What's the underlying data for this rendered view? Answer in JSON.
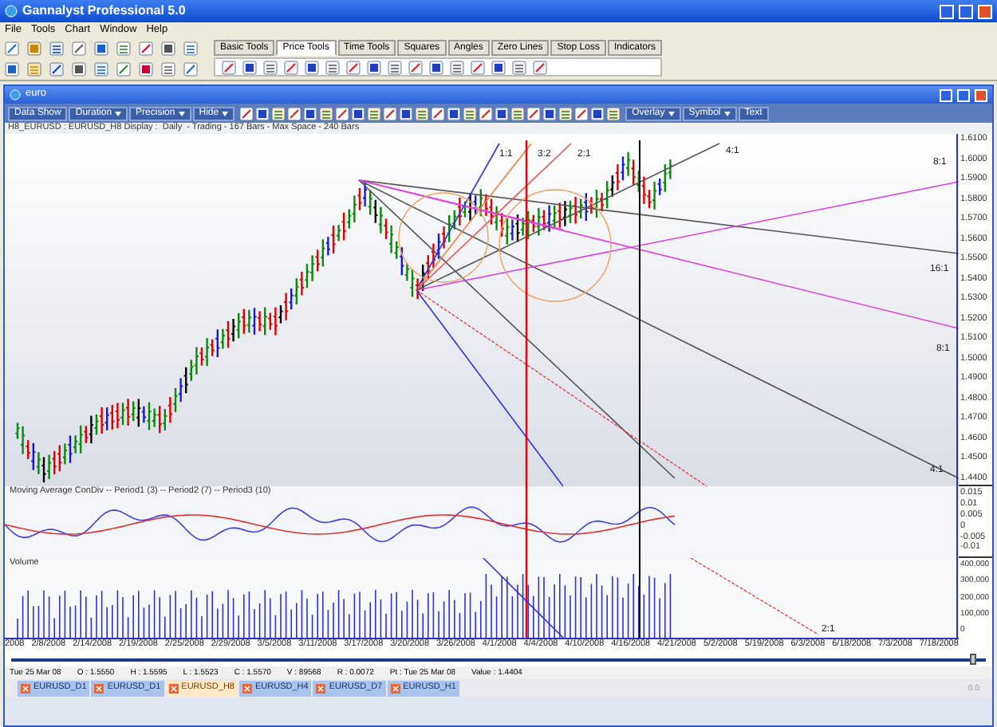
{
  "window": {
    "title": "Gannalyst Professional 5.0"
  },
  "menu": [
    "File",
    "Tools",
    "Chart",
    "Window",
    "Help"
  ],
  "tool_tabs": [
    {
      "label": "Basic Tools",
      "selected": false
    },
    {
      "label": "Price Tools",
      "selected": true
    },
    {
      "label": "Time Tools",
      "selected": false
    },
    {
      "label": "Squares",
      "selected": false
    },
    {
      "label": "Angles",
      "selected": false
    },
    {
      "label": "Zero Lines",
      "selected": false
    },
    {
      "label": "Stop Loss",
      "selected": false
    },
    {
      "label": "Indicators",
      "selected": false
    }
  ],
  "chart_window": {
    "title": "euro",
    "toolbar_left": [
      {
        "kind": "button",
        "label": "Data Show"
      },
      {
        "kind": "dropdown",
        "label": "Duration"
      },
      {
        "kind": "dropdown",
        "label": "Precision"
      },
      {
        "kind": "dropdown",
        "label": "Hide"
      }
    ],
    "toolbar_right": [
      {
        "kind": "dropdown",
        "label": "Overlay"
      },
      {
        "kind": "dropdown",
        "label": "Symbol"
      },
      {
        "kind": "button",
        "label": "Text"
      }
    ],
    "info": "H8_EURUSD : EURUSD_H8 Display :  Daily  - Trading - 167 Bars - Max Space - 240 Bars"
  },
  "price_chart": {
    "axis": [
      "1.6100",
      "1.6000",
      "1.5900",
      "1.5800",
      "1.5700",
      "1.5600",
      "1.5500",
      "1.5400",
      "1.5300",
      "1.5200",
      "1.5100",
      "1.5000",
      "1.4900",
      "1.4800",
      "1.4700",
      "1.4600",
      "1.4500",
      "1.4400"
    ],
    "line_labels": [
      "1:1",
      "3:2",
      "2:1",
      "4:1",
      "8:1",
      "16:1",
      "8:1",
      "4:1"
    ]
  },
  "oscillator": {
    "title": "Moving Average ConDiv -- Period1 (3) -- Period2 (7) -- Period3 (10)",
    "axis": [
      "0.015",
      "0.01",
      "0.005",
      "0",
      "-0.005",
      "-0.01"
    ]
  },
  "volume": {
    "title": "Volume",
    "axis": [
      "400,000",
      "300,000",
      "200,000",
      "100,000",
      "0"
    ],
    "line_label": "2:1"
  },
  "date_axis": [
    "2008",
    "2/8/2008",
    "2/14/2008",
    "2/19/2008",
    "2/25/2008",
    "2/29/2008",
    "3/5/2008",
    "3/11/2008",
    "3/17/2008",
    "3/20/2008",
    "3/26/2008",
    "4/1/2008",
    "4/4/2008",
    "4/10/2008",
    "4/16/2008",
    "4/21/2008",
    "5/2/2008",
    "5/19/2008",
    "6/3/2008",
    "6/18/2008",
    "7/3/2008",
    "7/18/2008"
  ],
  "status": [
    "Tue 25 Mar 08",
    "O : 1.5550",
    "H : 1.5595",
    "L : 1.5523",
    "C : 1.5570",
    "V : 89568",
    "R : 0.0072",
    "Pt : Tue 25 Mar 08",
    "Value : 1.4404"
  ],
  "symbol_tabs": [
    {
      "label": "EURUSD_D1",
      "selected": false
    },
    {
      "label": "EURUSD_D1",
      "selected": false
    },
    {
      "label": "EURUSD_H8",
      "selected": true
    },
    {
      "label": "EURUSD_H4",
      "selected": false
    },
    {
      "label": "EURUSD_D7",
      "selected": false
    },
    {
      "label": "EURUSD_H1",
      "selected": false
    }
  ],
  "tab_bar_note": "0.0"
}
